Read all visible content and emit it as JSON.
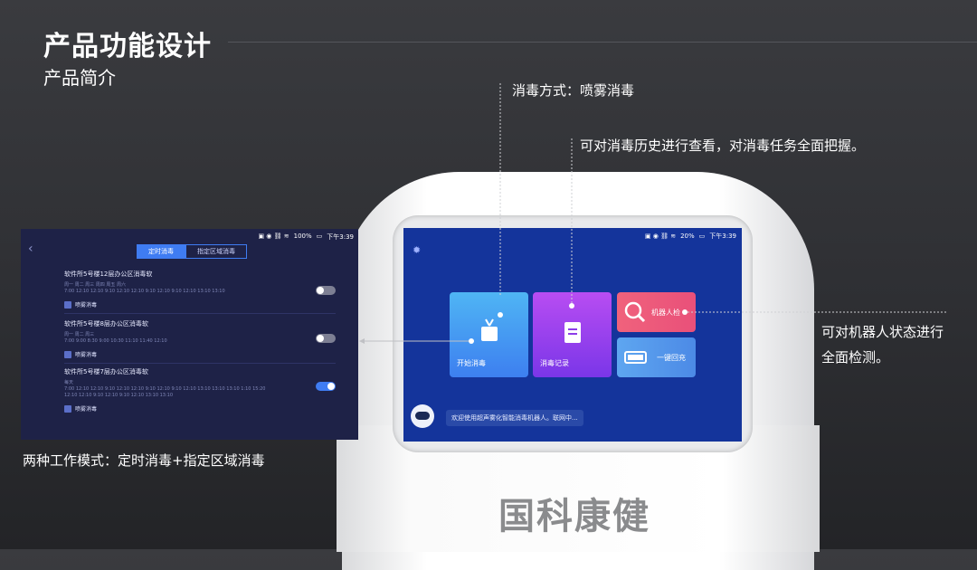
{
  "header": {
    "title": "产品功能设计",
    "subtitle": "产品简介"
  },
  "annotations": {
    "spray": "消毒方式：喷雾消毒",
    "history": "可对消毒历史进行查看，对消毒任务全面把握。",
    "status_line1": "可对机器人状态进行",
    "status_line2": "全面检测。",
    "modes": "两种工作模式：定时消毒+指定区域消毒"
  },
  "brand": "国科康健",
  "main_screen": {
    "status": {
      "battery": "20%",
      "time": "下午3:39"
    },
    "tiles": {
      "start": "开始消毒",
      "records": "消毒记录",
      "check": "机器人检",
      "charge": "一键回充"
    },
    "message": "欢迎使用超声雾化智能消毒机器人。联网中..."
  },
  "left_screen": {
    "status": {
      "battery": "100%",
      "time": "下午3:39"
    },
    "tabs": [
      "定时消毒",
      "指定区域消毒"
    ],
    "items": [
      {
        "name": "软件所5号楼12层办公区消毒软",
        "days": "周一 周二 周三 周四 周五 周六",
        "times": "7:00  12:10 12:10 9:10  12:10 12:10 9:10  12:10 9:10  12:10 13:10 13:10",
        "check": "喷雾消毒",
        "on": false
      },
      {
        "name": "软件所5号楼8层办公区消毒软",
        "days": "周一 周二 周三",
        "times": "7:00  9:00  8:30  9:00  10:30  11:10  11:40  12:10",
        "check": "喷雾消毒",
        "on": false
      },
      {
        "name": "软件所5号楼7层办公区消毒软",
        "days": "每天",
        "times": "7:00  12:10 12:10 9:10 12:10 12:10 9:10 12:10 9:10 12:10 13:10 13:10 13:10 1:10  15:20 12:10 12:10 9:10 12:10 9:10 12:10 13:10 13:10",
        "check": "喷雾消毒",
        "on": true
      }
    ]
  }
}
